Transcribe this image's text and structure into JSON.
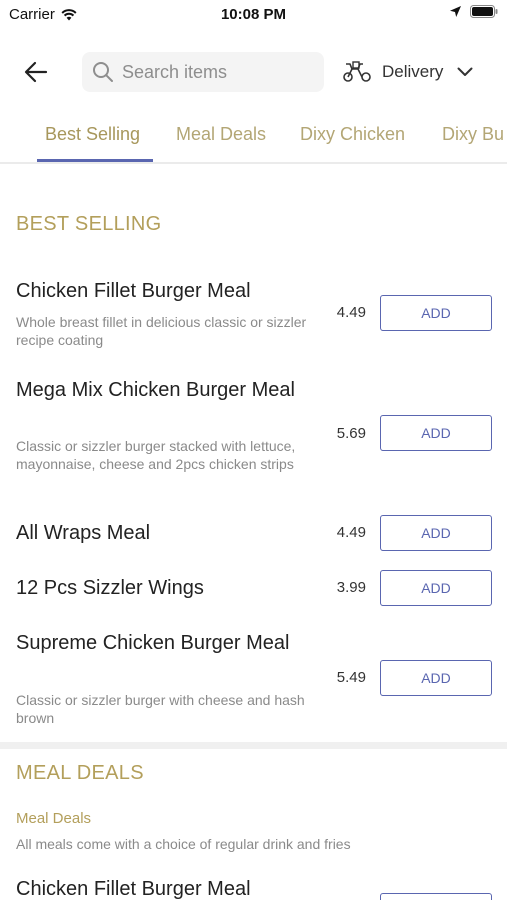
{
  "status": {
    "carrier": "Carrier",
    "time": "10:08 PM"
  },
  "search": {
    "placeholder": "Search items"
  },
  "delivery": {
    "label": "Delivery"
  },
  "tabs": [
    "Best Selling",
    "Meal Deals",
    "Dixy Chicken",
    "Dixy Bu"
  ],
  "sections": {
    "best_selling": "BEST SELLING",
    "meal_deals": "MEAL DEALS"
  },
  "add_label": "ADD",
  "items": [
    {
      "name": "Chicken Fillet Burger Meal",
      "desc": "Whole breast fillet in delicious classic or sizzler recipe coating",
      "price": "4.49"
    },
    {
      "name": "Mega Mix Chicken Burger Meal",
      "desc": "Classic or sizzler burger stacked with lettuce, mayonnaise, cheese and 2pcs chicken strips",
      "price": "5.69"
    },
    {
      "name": "All Wraps Meal",
      "desc": "",
      "price": "4.49"
    },
    {
      "name": "12 Pcs Sizzler Wings",
      "desc": "",
      "price": "3.99"
    },
    {
      "name": "Supreme Chicken Burger Meal",
      "desc": "Classic or sizzler burger with cheese and hash brown",
      "price": "5.49"
    }
  ],
  "meal_deals": {
    "subtitle": "Meal Deals",
    "desc": "All meals come with a choice of regular drink and fries",
    "first_item": "Chicken Fillet Burger Meal"
  }
}
